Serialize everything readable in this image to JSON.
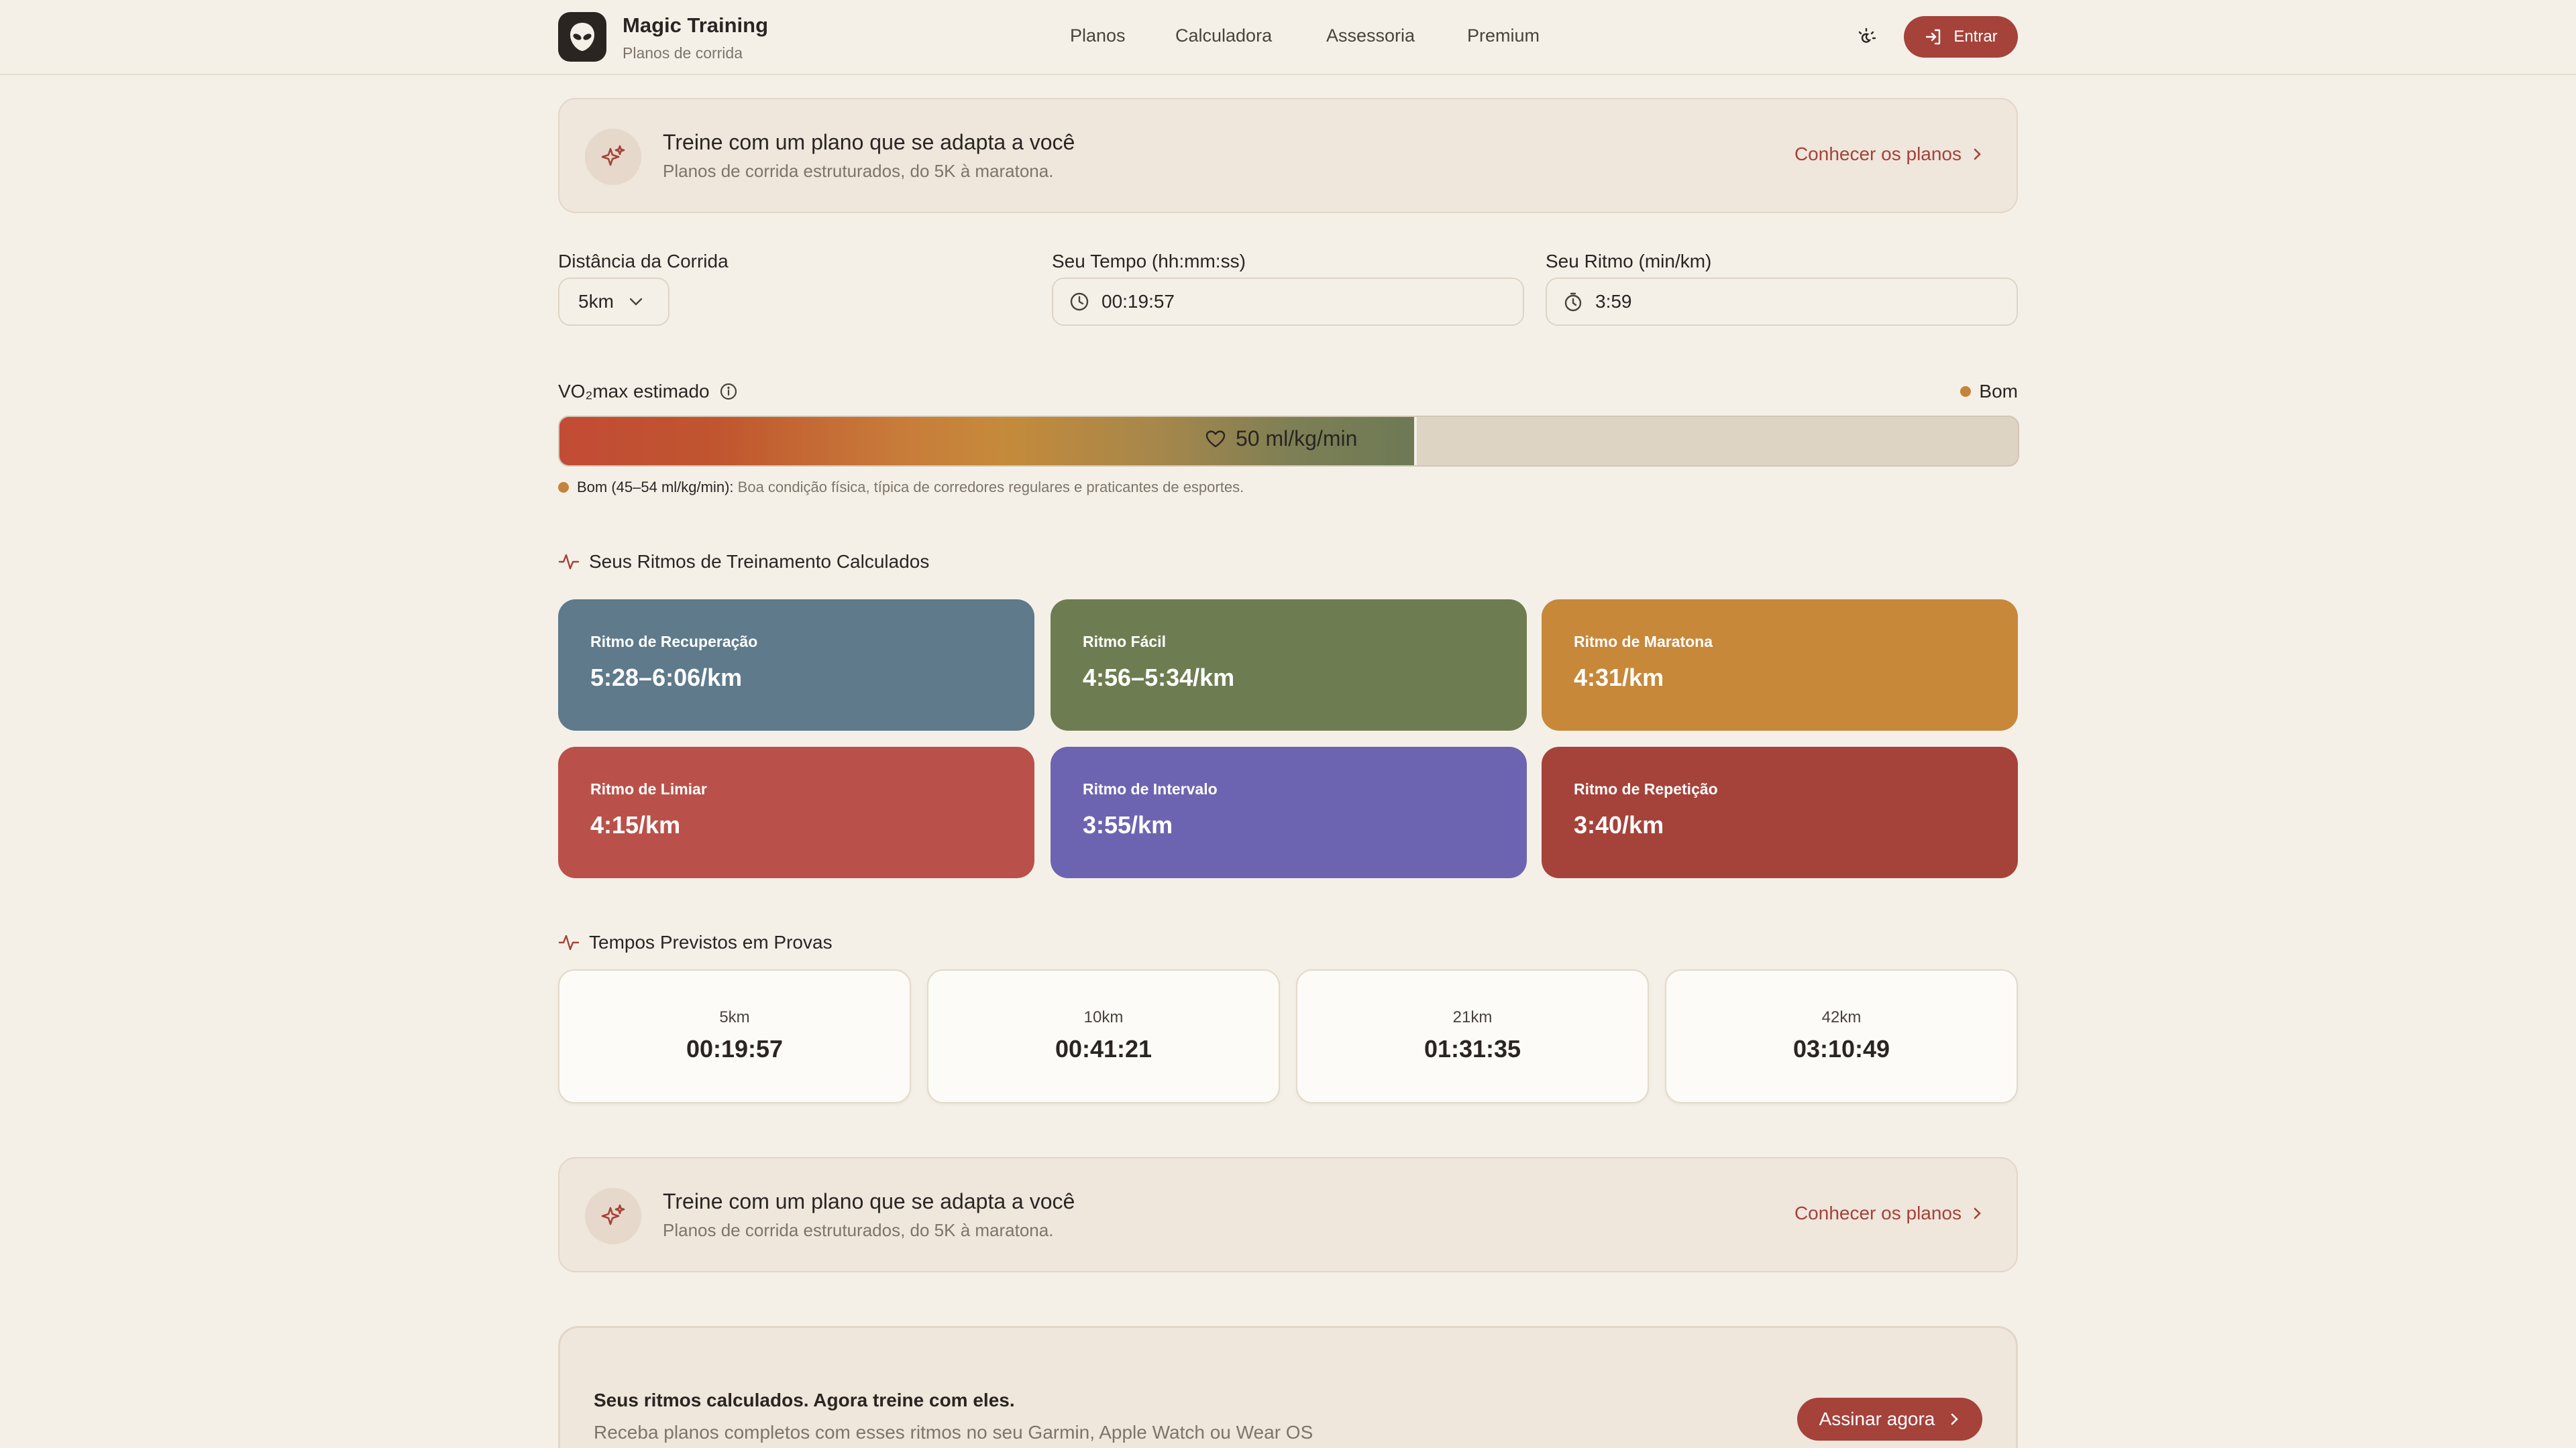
{
  "header": {
    "brand_name": "Magic Training",
    "brand_sub": "Planos de corrida",
    "nav": [
      "Planos",
      "Calculadora",
      "Assessoria",
      "Premium"
    ],
    "login_label": "Entrar",
    "icons": {
      "logo": "alien-head-icon",
      "theme": "theme-toggle-icon",
      "login": "sign-in-icon"
    }
  },
  "promo": {
    "title": "Treine com um plano que se adapta a você",
    "subtitle": "Planos de corrida estruturados, do 5K à maratona.",
    "link": "Conhecer os planos",
    "icon": "sparkles-icon"
  },
  "form": {
    "distance_label": "Distância da Corrida",
    "distance_value": "5km",
    "time_label": "Seu Tempo (hh:mm:ss)",
    "time_value": "00:19:57",
    "pace_label": "Seu Ritmo (min/km)",
    "pace_value": "3:59"
  },
  "vo2": {
    "label": "VO₂max estimado",
    "level": "Bom",
    "value": "50 ml/kg/min",
    "fill_fraction": 0.588,
    "desc_strong": "Bom (45–54 ml/kg/min):",
    "desc_text": "Boa condição física, típica de corredores regulares e praticantes de esportes."
  },
  "paces": {
    "title": "Seus Ritmos de Treinamento Calculados",
    "items": [
      {
        "name": "Ritmo de Recuperação",
        "value": "5:28–6:06/km",
        "color": "#5e7a8b"
      },
      {
        "name": "Ritmo Fácil",
        "value": "4:56–5:34/km",
        "color": "#6e7d51"
      },
      {
        "name": "Ritmo de Maratona",
        "value": "4:31/km",
        "color": "#c7883a"
      },
      {
        "name": "Ritmo de Limiar",
        "value": "4:15/km",
        "color": "#b9514a"
      },
      {
        "name": "Ritmo de Intervalo",
        "value": "3:55/km",
        "color": "#6d64b1"
      },
      {
        "name": "Ritmo de Repetição",
        "value": "3:40/km",
        "color": "#a5423a"
      }
    ]
  },
  "races": {
    "title": "Tempos Previstos em Provas",
    "items": [
      {
        "distance": "5km",
        "time": "00:19:57"
      },
      {
        "distance": "10km",
        "time": "00:41:21"
      },
      {
        "distance": "21km",
        "time": "01:31:35"
      },
      {
        "distance": "42km",
        "time": "03:10:49"
      }
    ]
  },
  "cta": {
    "title": "Seus ritmos calculados. Agora treine com eles.",
    "subtitle": "Receba planos completos com esses ritmos no seu Garmin, Apple Watch ou Wear OS",
    "button": "Assinar agora"
  },
  "colors": {
    "accent": "#a5423a",
    "background": "#f4f0e8",
    "good": "#c4843b"
  }
}
